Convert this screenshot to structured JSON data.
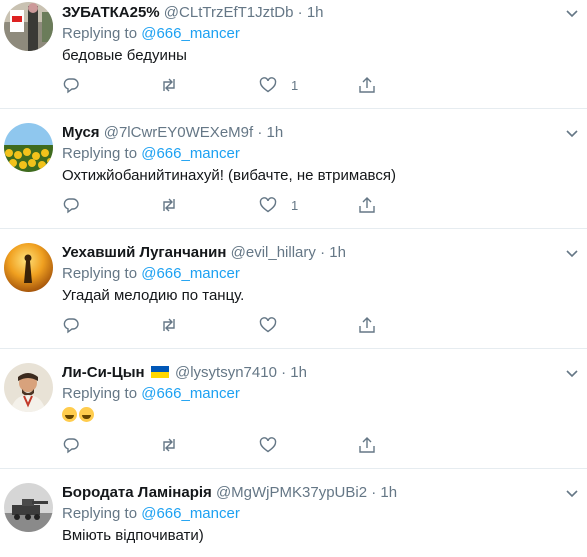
{
  "replying_label": "Replying to",
  "tweets": [
    {
      "name": "ЗУБАТКА25%",
      "handle": "@CLtTrzEfT1JztDb",
      "dot": "·",
      "time": "1h",
      "replying_to": "@666_mancer",
      "text": "бедовые бедуины",
      "likes": "1"
    },
    {
      "name": "Муся",
      "handle": "@7lCwrEY0WEXeM9f",
      "dot": "·",
      "time": "1h",
      "replying_to": "@666_mancer",
      "text": "Охтижйобанийтинахуй! (вибачте, не втримався)",
      "likes": "1"
    },
    {
      "name": "Уехавший Луганчанин",
      "handle": "@evil_hillary",
      "dot": "·",
      "time": "1h",
      "replying_to": "@666_mancer",
      "text": "Угадай мелодию по танцу.",
      "likes": ""
    },
    {
      "name": "Ли-Си-Цын",
      "handle": "@lysytsyn7410",
      "dot": "·",
      "time": "1h",
      "replying_to": "@666_mancer",
      "text": "",
      "likes": ""
    },
    {
      "name": "Бородата Ламінарія",
      "handle": "@MgWjPMK37ypUBi2",
      "dot": "·",
      "time": "1h",
      "replying_to": "@666_mancer",
      "text": "Вміють відпочивати)",
      "likes": ""
    }
  ],
  "icons": {
    "reply": "reply-icon",
    "retweet": "retweet-icon",
    "like": "like-icon",
    "share": "share-icon",
    "more": "chevron-down-icon",
    "emoji": "rolling-on-floor-laughing-emoji",
    "flag": "ukraine-flag-icon"
  },
  "colors": {
    "link": "#1da1f2",
    "muted": "#657786",
    "text": "#14171a",
    "border": "#e6ecf0",
    "flag_blue": "#0057b7",
    "flag_yellow": "#ffd700"
  }
}
